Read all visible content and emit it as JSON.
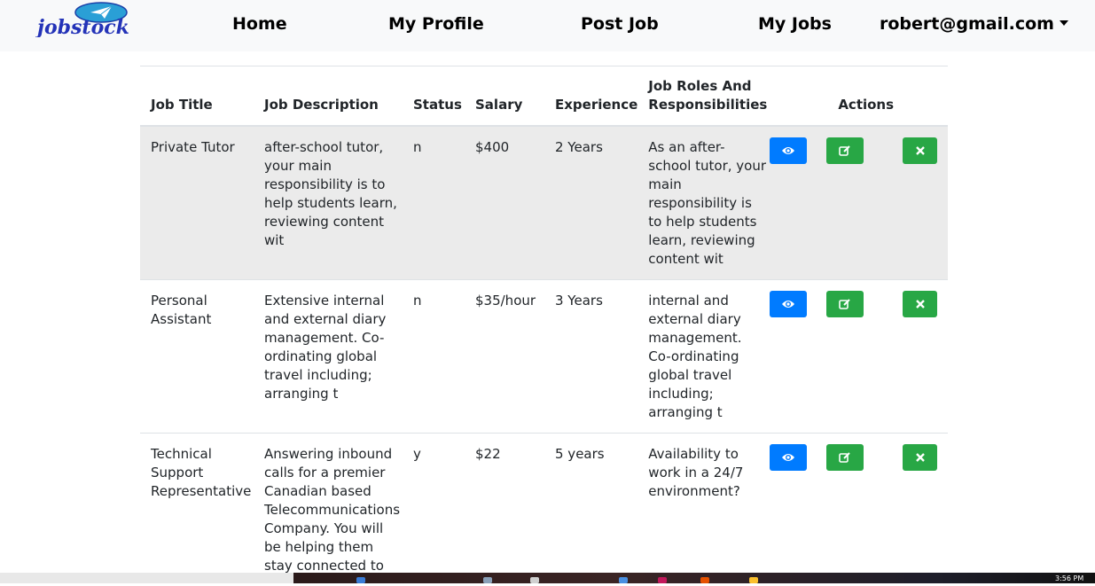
{
  "brand": {
    "logo_text": "jobstock"
  },
  "nav": {
    "home": "Home",
    "profile": "My Profile",
    "post_job": "Post Job",
    "my_jobs": "My Jobs",
    "user": "robert@gmail.com"
  },
  "table": {
    "headers": {
      "title": "Job Title",
      "description": "Job Description",
      "status": "Status",
      "salary": "Salary",
      "experience": "Experience",
      "roles": "Job Roles And Responsibilities",
      "actions": "Actions"
    },
    "rows": [
      {
        "title": "Private Tutor",
        "description": "after-school tutor, your main responsibility is to help students learn, reviewing content wit",
        "status": "n",
        "salary": "$400",
        "experience": "2 Years",
        "roles": "As an after-school tutor, your main responsibility is to help students learn, reviewing content wit"
      },
      {
        "title": "Personal Assistant",
        "description": "Extensive internal and external diary management. Co-ordinating global travel including; arranging t",
        "status": "n",
        "salary": "$35/hour",
        "experience": "3 Years",
        "roles": "internal and external diary management. Co-ordinating global travel including; arranging t"
      },
      {
        "title": "Technical Support Representative",
        "description": "Answering inbound calls for a premier Canadian based Telecommunications Company. You will be helping them stay connected to",
        "status": "y",
        "salary": "$22",
        "experience": "5 years",
        "roles": "Availability to work in a 24/7 environment?"
      }
    ]
  },
  "taskbar": {
    "clock": "3:56 PM"
  },
  "colors": {
    "view": "#007bff",
    "edit": "#28a745",
    "delete": "#28a745",
    "row_highlight": "#ebebeb",
    "navbar": "#f8f9fa"
  },
  "icons": {
    "view": "eye-icon",
    "edit": "edit-icon",
    "delete": "close-icon",
    "dropdown": "caret-down-icon"
  }
}
